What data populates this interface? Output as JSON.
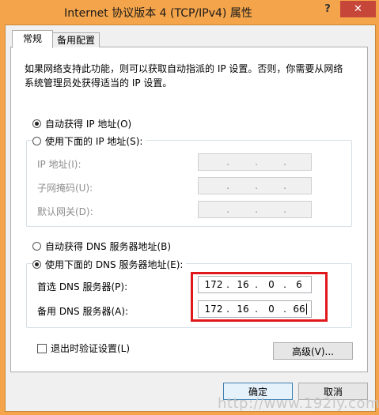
{
  "window": {
    "title": "Internet 协议版本 4 (TCP/IPv4) 属性",
    "help_label": "?",
    "close_label": "✕"
  },
  "tabs": [
    {
      "label": "常规",
      "active": true
    },
    {
      "label": "备用配置",
      "active": false
    }
  ],
  "description": "如果网络支持此功能，则可以获取自动指派的 IP 设置。否则，你需要从网络系统管理员处获得适当的 IP 设置。",
  "ip_section": {
    "auto_label": "自动获得 IP 地址(O)",
    "manual_label": "使用下面的 IP 地址(S):",
    "selected": "auto",
    "fields": [
      {
        "label": "IP 地址(I):",
        "value": [
          "",
          "",
          "",
          ""
        ]
      },
      {
        "label": "子网掩码(U):",
        "value": [
          "",
          "",
          "",
          ""
        ]
      },
      {
        "label": "默认网关(D):",
        "value": [
          "",
          "",
          "",
          ""
        ]
      }
    ]
  },
  "dns_section": {
    "auto_label": "自动获得 DNS 服务器地址(B)",
    "manual_label": "使用下面的 DNS 服务器地址(E):",
    "selected": "manual",
    "fields": [
      {
        "label": "首选 DNS 服务器(P):",
        "value": [
          "172",
          "16",
          "0",
          "6"
        ]
      },
      {
        "label": "备用 DNS 服务器(A):",
        "value": [
          "172",
          "16",
          "0",
          "66"
        ]
      }
    ]
  },
  "validate_label": "退出时验证设置(L)",
  "validate_checked": false,
  "buttons": {
    "advanced": "高级(V)...",
    "ok": "确定",
    "cancel": "取消"
  },
  "watermark": "http://www.192ly.com",
  "colors": {
    "frame": "#f4a44a",
    "close": "#c7463a",
    "highlight": "#e0181c"
  }
}
